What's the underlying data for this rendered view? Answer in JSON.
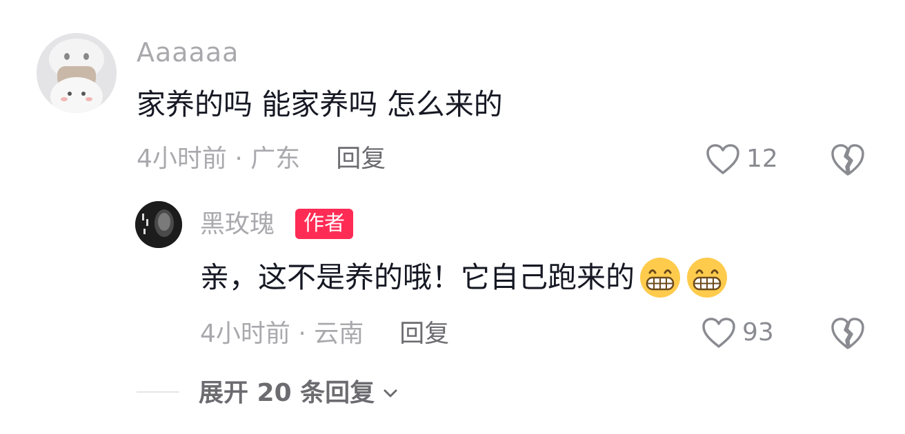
{
  "comment": {
    "username": "Aaaaaa",
    "text": "家养的吗 能家养吗 怎么来的",
    "meta": "4小时前 · 广东",
    "reply_label": "回复",
    "likes": "12"
  },
  "reply": {
    "username": "黑玫瑰",
    "badge": "作者",
    "text": "亲，这不是养的哦！它自己跑来的",
    "emojis": [
      "grin-emoji",
      "grin-emoji"
    ],
    "meta": "4小时前 · 云南",
    "reply_label": "回复",
    "likes": "93"
  },
  "expand": {
    "label": "展开 20 条回复"
  },
  "colors": {
    "text_primary": "#161823",
    "text_secondary": "#a9a9ad",
    "badge_bg": "#fe2c55",
    "badge_text": "#ffffff"
  }
}
